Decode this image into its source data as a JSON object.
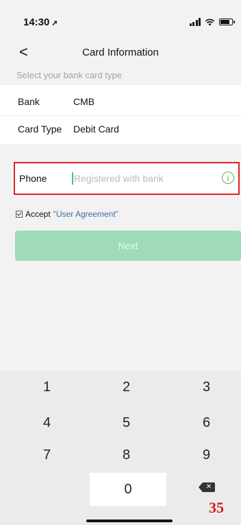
{
  "status_bar": {
    "time": "14:30",
    "location_arrow": "➚",
    "icons": [
      "signal-icon",
      "wifi-icon",
      "battery-icon"
    ]
  },
  "nav": {
    "back_glyph": "<",
    "title": "Card Information"
  },
  "hint": "Select your bank card type",
  "card_info": {
    "bank_label": "Bank",
    "bank_value": "CMB",
    "type_label": "Card Type",
    "type_value": "Debit Card"
  },
  "phone": {
    "label": "Phone",
    "value": "",
    "placeholder": "Registered with bank",
    "info_glyph": "i"
  },
  "agreement": {
    "checked": true,
    "prefix": "Accept",
    "link": "\"User Agreement\""
  },
  "next_label": "Next",
  "keypad": {
    "keys": [
      "1",
      "2",
      "3",
      "4",
      "5",
      "6",
      "7",
      "8",
      "9",
      "0"
    ],
    "backspace_glyph": "✕"
  },
  "annotation_badge": "35",
  "colors": {
    "accent_green": "#52b849",
    "next_disabled": "#9fdbb6",
    "highlight_red": "#e02020",
    "link_blue": "#3b6ea5"
  }
}
